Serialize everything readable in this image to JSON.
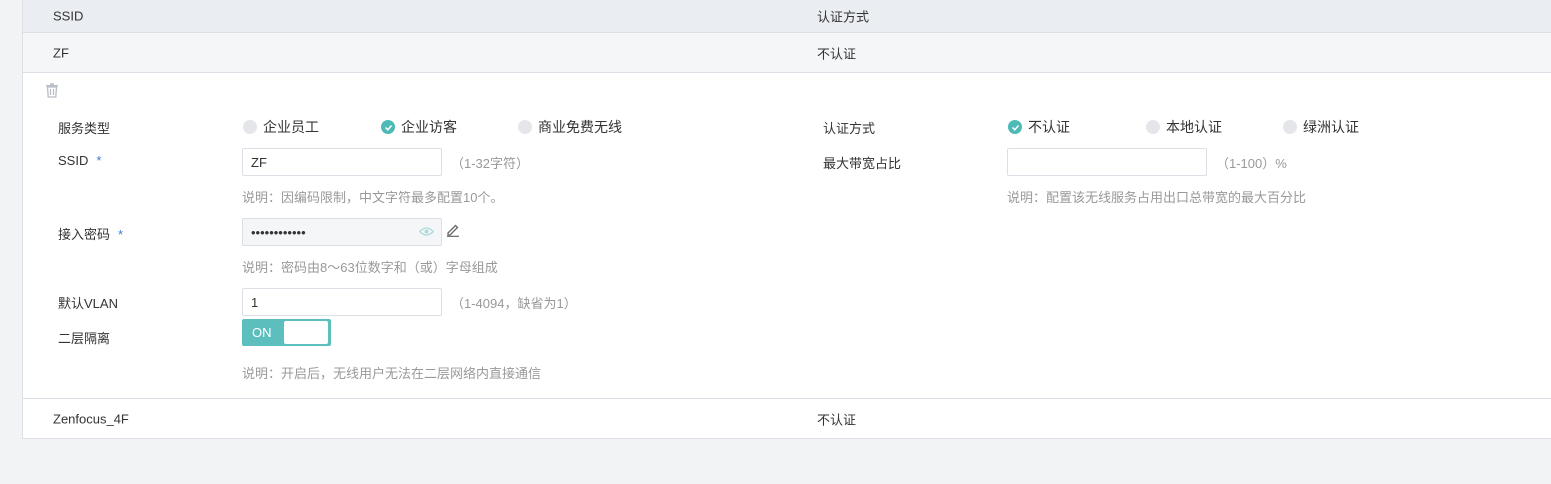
{
  "table": {
    "headers": [
      "SSID",
      "认证方式"
    ],
    "rows": [
      {
        "ssid": "ZF",
        "auth": "不认证"
      },
      {
        "ssid": "Zenfocus_4F",
        "auth": "不认证"
      }
    ]
  },
  "form": {
    "service_type": {
      "label": "服务类型",
      "options": [
        "企业员工",
        "企业访客",
        "商业免费无线"
      ],
      "selected_index": 1
    },
    "ssid": {
      "label": "SSID",
      "required_mark": "*",
      "value": "ZF",
      "hint": "（1-32字符）",
      "help": "说明：因编码限制，中文字符最多配置10个。"
    },
    "password": {
      "label": "接入密码",
      "required_mark": "*",
      "value": "••••••••••••",
      "help": "说明：密码由8～63位数字和（或）字母组成"
    },
    "vlan": {
      "label": "默认VLAN",
      "value": "1",
      "hint": "（1-4094，缺省为1）"
    },
    "isolation": {
      "label": "二层隔离",
      "state": "ON",
      "help": "说明：开启后，无线用户无法在二层网络内直接通信"
    },
    "auth": {
      "label": "认证方式",
      "options": [
        "不认证",
        "本地认证",
        "绿洲认证"
      ],
      "selected_index": 0
    },
    "bandwidth": {
      "label": "最大带宽占比",
      "value": "",
      "hint": "（1-100）%",
      "help": "说明：配置该无线服务占用出口总带宽的最大百分比"
    }
  },
  "icons": {
    "delete": "trash-icon",
    "eye": "eye-icon",
    "edit": "pencil-icon",
    "check": "check-icon"
  },
  "colors": {
    "accent": "#4dbab6",
    "toggle": "#5cbfbd",
    "required": "#3b7fd6",
    "header_bg": "#eaedf1"
  }
}
